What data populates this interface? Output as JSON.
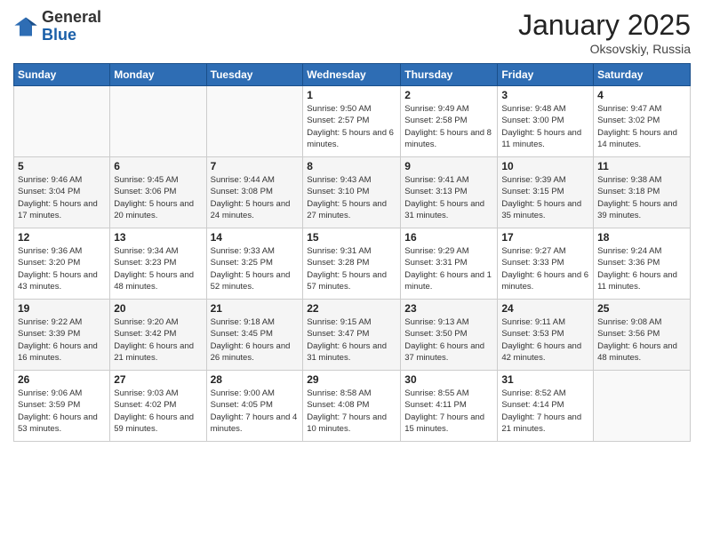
{
  "header": {
    "logo": {
      "general": "General",
      "blue": "Blue"
    },
    "title": "January 2025",
    "subtitle": "Oksovskiy, Russia"
  },
  "days_of_week": [
    "Sunday",
    "Monday",
    "Tuesday",
    "Wednesday",
    "Thursday",
    "Friday",
    "Saturday"
  ],
  "weeks": [
    [
      {
        "num": "",
        "info": ""
      },
      {
        "num": "",
        "info": ""
      },
      {
        "num": "",
        "info": ""
      },
      {
        "num": "1",
        "info": "Sunrise: 9:50 AM\nSunset: 2:57 PM\nDaylight: 5 hours and 6 minutes."
      },
      {
        "num": "2",
        "info": "Sunrise: 9:49 AM\nSunset: 2:58 PM\nDaylight: 5 hours and 8 minutes."
      },
      {
        "num": "3",
        "info": "Sunrise: 9:48 AM\nSunset: 3:00 PM\nDaylight: 5 hours and 11 minutes."
      },
      {
        "num": "4",
        "info": "Sunrise: 9:47 AM\nSunset: 3:02 PM\nDaylight: 5 hours and 14 minutes."
      }
    ],
    [
      {
        "num": "5",
        "info": "Sunrise: 9:46 AM\nSunset: 3:04 PM\nDaylight: 5 hours and 17 minutes."
      },
      {
        "num": "6",
        "info": "Sunrise: 9:45 AM\nSunset: 3:06 PM\nDaylight: 5 hours and 20 minutes."
      },
      {
        "num": "7",
        "info": "Sunrise: 9:44 AM\nSunset: 3:08 PM\nDaylight: 5 hours and 24 minutes."
      },
      {
        "num": "8",
        "info": "Sunrise: 9:43 AM\nSunset: 3:10 PM\nDaylight: 5 hours and 27 minutes."
      },
      {
        "num": "9",
        "info": "Sunrise: 9:41 AM\nSunset: 3:13 PM\nDaylight: 5 hours and 31 minutes."
      },
      {
        "num": "10",
        "info": "Sunrise: 9:39 AM\nSunset: 3:15 PM\nDaylight: 5 hours and 35 minutes."
      },
      {
        "num": "11",
        "info": "Sunrise: 9:38 AM\nSunset: 3:18 PM\nDaylight: 5 hours and 39 minutes."
      }
    ],
    [
      {
        "num": "12",
        "info": "Sunrise: 9:36 AM\nSunset: 3:20 PM\nDaylight: 5 hours and 43 minutes."
      },
      {
        "num": "13",
        "info": "Sunrise: 9:34 AM\nSunset: 3:23 PM\nDaylight: 5 hours and 48 minutes."
      },
      {
        "num": "14",
        "info": "Sunrise: 9:33 AM\nSunset: 3:25 PM\nDaylight: 5 hours and 52 minutes."
      },
      {
        "num": "15",
        "info": "Sunrise: 9:31 AM\nSunset: 3:28 PM\nDaylight: 5 hours and 57 minutes."
      },
      {
        "num": "16",
        "info": "Sunrise: 9:29 AM\nSunset: 3:31 PM\nDaylight: 6 hours and 1 minute."
      },
      {
        "num": "17",
        "info": "Sunrise: 9:27 AM\nSunset: 3:33 PM\nDaylight: 6 hours and 6 minutes."
      },
      {
        "num": "18",
        "info": "Sunrise: 9:24 AM\nSunset: 3:36 PM\nDaylight: 6 hours and 11 minutes."
      }
    ],
    [
      {
        "num": "19",
        "info": "Sunrise: 9:22 AM\nSunset: 3:39 PM\nDaylight: 6 hours and 16 minutes."
      },
      {
        "num": "20",
        "info": "Sunrise: 9:20 AM\nSunset: 3:42 PM\nDaylight: 6 hours and 21 minutes."
      },
      {
        "num": "21",
        "info": "Sunrise: 9:18 AM\nSunset: 3:45 PM\nDaylight: 6 hours and 26 minutes."
      },
      {
        "num": "22",
        "info": "Sunrise: 9:15 AM\nSunset: 3:47 PM\nDaylight: 6 hours and 31 minutes."
      },
      {
        "num": "23",
        "info": "Sunrise: 9:13 AM\nSunset: 3:50 PM\nDaylight: 6 hours and 37 minutes."
      },
      {
        "num": "24",
        "info": "Sunrise: 9:11 AM\nSunset: 3:53 PM\nDaylight: 6 hours and 42 minutes."
      },
      {
        "num": "25",
        "info": "Sunrise: 9:08 AM\nSunset: 3:56 PM\nDaylight: 6 hours and 48 minutes."
      }
    ],
    [
      {
        "num": "26",
        "info": "Sunrise: 9:06 AM\nSunset: 3:59 PM\nDaylight: 6 hours and 53 minutes."
      },
      {
        "num": "27",
        "info": "Sunrise: 9:03 AM\nSunset: 4:02 PM\nDaylight: 6 hours and 59 minutes."
      },
      {
        "num": "28",
        "info": "Sunrise: 9:00 AM\nSunset: 4:05 PM\nDaylight: 7 hours and 4 minutes."
      },
      {
        "num": "29",
        "info": "Sunrise: 8:58 AM\nSunset: 4:08 PM\nDaylight: 7 hours and 10 minutes."
      },
      {
        "num": "30",
        "info": "Sunrise: 8:55 AM\nSunset: 4:11 PM\nDaylight: 7 hours and 15 minutes."
      },
      {
        "num": "31",
        "info": "Sunrise: 8:52 AM\nSunset: 4:14 PM\nDaylight: 7 hours and 21 minutes."
      },
      {
        "num": "",
        "info": ""
      }
    ]
  ]
}
